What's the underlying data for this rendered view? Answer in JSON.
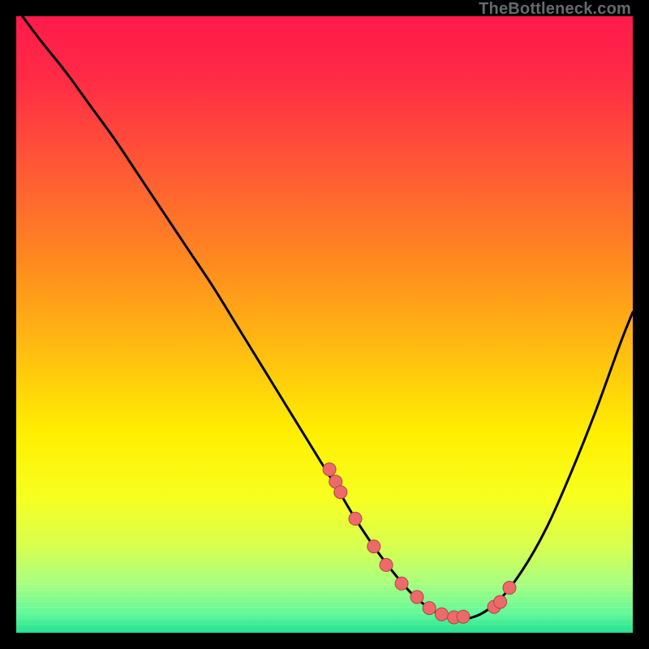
{
  "watermark": "TheBottleneck.com",
  "chart_data": {
    "type": "line",
    "title": "",
    "xlabel": "",
    "ylabel": "",
    "xlim": [
      0,
      100
    ],
    "ylim": [
      0,
      100
    ],
    "series": [
      {
        "name": "curve",
        "x": [
          1,
          4,
          8,
          12,
          16,
          20,
          24,
          28,
          32,
          36,
          40,
          44,
          48,
          52,
          55,
          58,
          61,
          64,
          67,
          70,
          74,
          78,
          82,
          86,
          90,
          94,
          98,
          100
        ],
        "y": [
          100,
          96,
          91,
          85.5,
          80,
          74,
          68,
          62,
          56,
          49.5,
          43,
          36.5,
          30,
          23.5,
          18.5,
          14,
          10,
          6.5,
          4,
          2.5,
          2.5,
          5,
          10,
          17,
          26,
          36,
          47,
          52
        ]
      }
    ],
    "scatter": {
      "name": "points",
      "x": [
        50.8,
        51.8,
        52.6,
        55.0,
        58.0,
        60.0,
        62.5,
        65.0,
        67.0,
        69.0,
        71.0,
        72.5,
        77.5,
        78.5,
        80.0
      ],
      "y": [
        26.5,
        24.5,
        22.8,
        18.5,
        14.0,
        11.0,
        8.0,
        5.8,
        4.0,
        3.0,
        2.5,
        2.6,
        4.2,
        5.0,
        7.3
      ]
    },
    "gradient_stops": [
      {
        "offset": 0.0,
        "color": "#ff1a4b"
      },
      {
        "offset": 0.1,
        "color": "#ff2b45"
      },
      {
        "offset": 0.25,
        "color": "#ff5a35"
      },
      {
        "offset": 0.4,
        "color": "#ff8a1f"
      },
      {
        "offset": 0.55,
        "color": "#ffc010"
      },
      {
        "offset": 0.68,
        "color": "#fff000"
      },
      {
        "offset": 0.78,
        "color": "#f7ff20"
      },
      {
        "offset": 0.86,
        "color": "#d8ff50"
      },
      {
        "offset": 0.92,
        "color": "#a8ff80"
      },
      {
        "offset": 0.97,
        "color": "#60f89a"
      },
      {
        "offset": 1.0,
        "color": "#20e090"
      }
    ],
    "point_fill": "#ed6a6a",
    "point_stroke": "#b34444",
    "curve_stroke": "#000000"
  }
}
